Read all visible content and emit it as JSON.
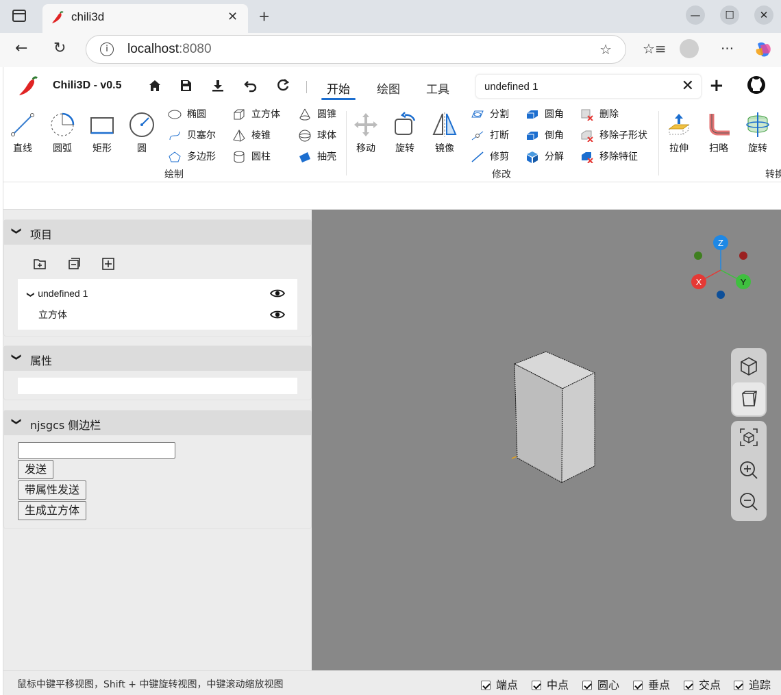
{
  "browser": {
    "tab_title": "chili3d",
    "tab_close": "✕",
    "new_tab": "+",
    "url_host": "localhost",
    "url_port": ":8080",
    "win_min": "—",
    "win_max": "☐",
    "win_close": "✕"
  },
  "app": {
    "title": "Chili3D - v0.5",
    "menu_tabs": [
      "开始",
      "绘图",
      "工具"
    ],
    "active_tab": "开始",
    "document_tab": "undefined 1",
    "doc_close": "✕",
    "add_doc": "+"
  },
  "ribbon": {
    "draw": {
      "big": [
        "直线",
        "圆弧",
        "矩形",
        "圆"
      ],
      "small_col1": [
        "椭圆",
        "贝塞尔",
        "多边形"
      ],
      "small_col2": [
        "立方体",
        "棱锥",
        "圆柱"
      ],
      "small_col3": [
        "圆锥",
        "球体",
        "抽壳"
      ],
      "label": "绘制"
    },
    "modify": {
      "big": [
        "移动",
        "旋转",
        "镜像"
      ],
      "small_col1": [
        "分割",
        "打断",
        "修剪"
      ],
      "small_col2": [
        "圆角",
        "倒角",
        "分解"
      ],
      "small_col3": [
        "删除",
        "移除子形状",
        "移除特征"
      ],
      "label": "修改"
    },
    "convert": {
      "big": [
        "拉伸",
        "扫略",
        "旋转"
      ],
      "label": "转换"
    }
  },
  "panels": {
    "project": {
      "title": "项目",
      "tree": [
        {
          "label": "undefined 1",
          "expanded": true
        },
        {
          "label": "立方体"
        }
      ]
    },
    "properties": {
      "title": "属性"
    },
    "sidebar": {
      "title": "njsgcs 侧边栏",
      "input_value": "",
      "buttons": [
        "发送",
        "带属性发送",
        "生成立方体"
      ]
    }
  },
  "viewport": {
    "background": "#888888",
    "axes": {
      "x": "X",
      "y": "Y",
      "z": "Z"
    },
    "axis_colors": {
      "x": "#e53935",
      "y": "#3fbf3f",
      "z": "#1e88e5"
    }
  },
  "statusbar": {
    "hint": "鼠标中键平移视图，Shift + 中键旋转视图，中键滚动缩放视图",
    "snaps": [
      {
        "label": "端点",
        "checked": true
      },
      {
        "label": "中点",
        "checked": true
      },
      {
        "label": "圆心",
        "checked": true
      },
      {
        "label": "垂点",
        "checked": true
      },
      {
        "label": "交点",
        "checked": true
      },
      {
        "label": "追踪",
        "checked": true
      }
    ]
  }
}
